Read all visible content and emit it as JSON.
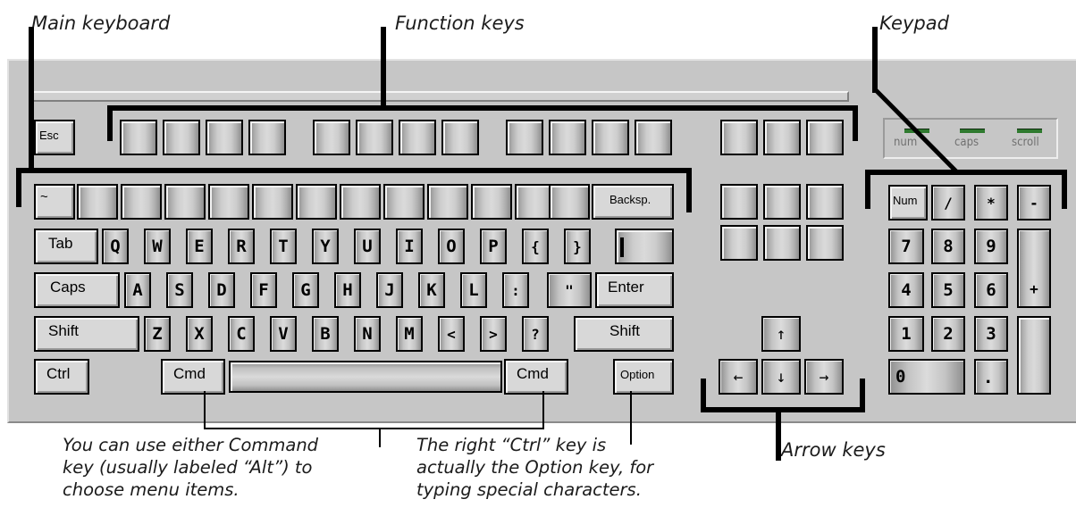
{
  "callouts": {
    "main_keyboard": "Main keyboard",
    "function_keys": "Function keys",
    "keypad": "Keypad",
    "arrow_keys": "Arrow keys"
  },
  "notes": {
    "command_key": "You can use either Command\nkey (usually labeled “Alt”) to\nchoose menu items.",
    "option_key": "The right “Ctrl” key is\nactually the Option key, for\ntyping special characters."
  },
  "keys": {
    "esc": "Esc",
    "tilde": "~",
    "backspace": "Backsp.",
    "tab": "Tab",
    "caps": "Caps",
    "enter": "Enter",
    "shift_left": "Shift",
    "shift_right": "Shift",
    "ctrl": "Ctrl",
    "cmd_left": "Cmd",
    "cmd_right": "Cmd",
    "option": "Option",
    "row_q": [
      "Q",
      "W",
      "E",
      "R",
      "T",
      "Y",
      "U",
      "I",
      "O",
      "P",
      "{",
      "}"
    ],
    "row_a": [
      "A",
      "S",
      "D",
      "F",
      "G",
      "H",
      "J",
      "K",
      "L",
      ":",
      "\""
    ],
    "row_z": [
      "Z",
      "X",
      "C",
      "V",
      "B",
      "N",
      "M",
      "<",
      ">",
      "?"
    ],
    "arrows": {
      "up": "↑",
      "left": "←",
      "down": "↓",
      "right": "→"
    }
  },
  "indicators": {
    "num": "num",
    "caps": "caps",
    "scroll": "scroll"
  },
  "keypad": {
    "num": "Num",
    "divide": "/",
    "multiply": "*",
    "minus": "-",
    "plus": "+",
    "digits": [
      "7",
      "8",
      "9",
      "4",
      "5",
      "6",
      "1",
      "2",
      "3"
    ],
    "zero": "0",
    "decimal": "."
  }
}
